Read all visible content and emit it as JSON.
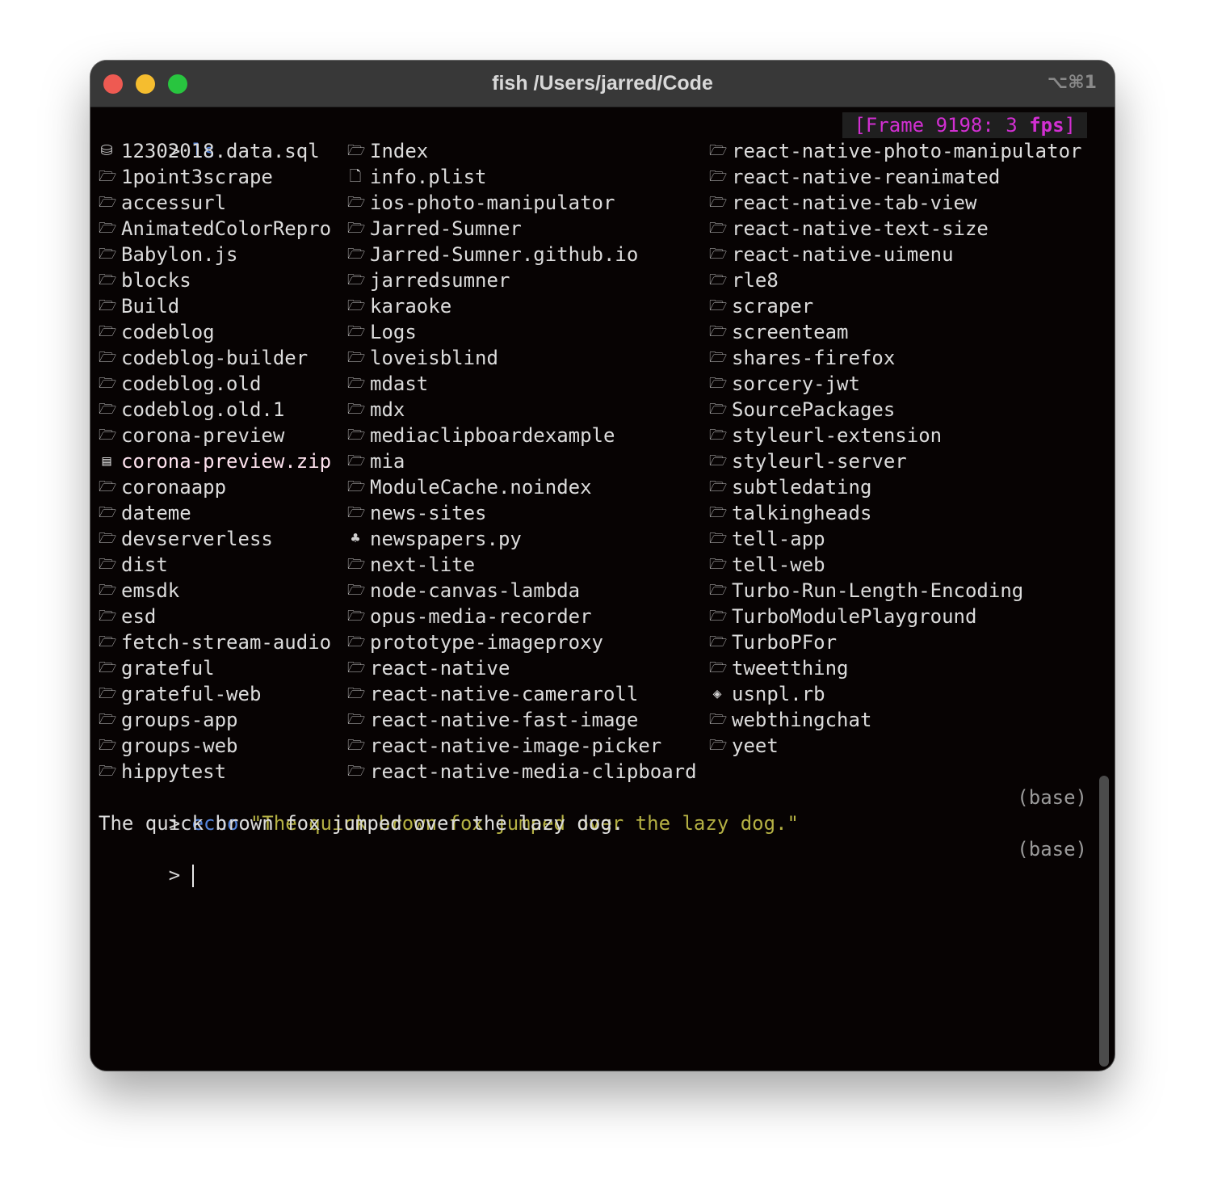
{
  "window": {
    "title": "fish /Users/jarred/Code",
    "shortcut": "⌥⌘1"
  },
  "colors": {
    "background": "#070303",
    "titlebar": "#383838",
    "command": "#5585dc",
    "string": "#b5b144",
    "fps": "#d22fd2",
    "zip": "#ffe3ef"
  },
  "overlay": {
    "frame_prefix": "[Frame 9198: 3 ",
    "frame_fps": "fps",
    "frame_suffix": "]"
  },
  "prompt_symbol": ">",
  "first_command": "ls",
  "listing": {
    "columns": [
      [
        {
          "icon": "database-icon",
          "name": "12302018.data.sql"
        },
        {
          "icon": "folder-icon",
          "name": "1point3scrape"
        },
        {
          "icon": "folder-icon",
          "name": "accessurl"
        },
        {
          "icon": "folder-icon",
          "name": "AnimatedColorRepro"
        },
        {
          "icon": "folder-icon",
          "name": "Babylon.js"
        },
        {
          "icon": "folder-icon",
          "name": "blocks"
        },
        {
          "icon": "folder-icon",
          "name": "Build"
        },
        {
          "icon": "folder-icon",
          "name": "codeblog"
        },
        {
          "icon": "folder-icon",
          "name": "codeblog-builder"
        },
        {
          "icon": "folder-icon",
          "name": "codeblog.old"
        },
        {
          "icon": "folder-icon",
          "name": "codeblog.old.1"
        },
        {
          "icon": "folder-icon",
          "name": "corona-preview"
        },
        {
          "icon": "zip-icon",
          "name": "corona-preview.zip"
        },
        {
          "icon": "folder-icon",
          "name": "coronaapp"
        },
        {
          "icon": "folder-icon",
          "name": "dateme"
        },
        {
          "icon": "folder-icon",
          "name": "devserverless"
        },
        {
          "icon": "folder-icon",
          "name": "dist"
        },
        {
          "icon": "folder-icon",
          "name": "emsdk"
        },
        {
          "icon": "folder-icon",
          "name": "esd"
        },
        {
          "icon": "folder-icon",
          "name": "fetch-stream-audio"
        },
        {
          "icon": "folder-icon",
          "name": "grateful"
        },
        {
          "icon": "folder-icon",
          "name": "grateful-web"
        },
        {
          "icon": "folder-icon",
          "name": "groups-app"
        },
        {
          "icon": "folder-icon",
          "name": "groups-web"
        },
        {
          "icon": "folder-icon",
          "name": "hippytest"
        }
      ],
      [
        {
          "icon": "folder-icon",
          "name": "Index"
        },
        {
          "icon": "file-icon",
          "name": "info.plist"
        },
        {
          "icon": "folder-icon",
          "name": "ios-photo-manipulator"
        },
        {
          "icon": "folder-icon",
          "name": "Jarred-Sumner"
        },
        {
          "icon": "folder-icon",
          "name": "Jarred-Sumner.github.io"
        },
        {
          "icon": "folder-icon",
          "name": "jarredsumner"
        },
        {
          "icon": "folder-icon",
          "name": "karaoke"
        },
        {
          "icon": "folder-icon",
          "name": "Logs"
        },
        {
          "icon": "folder-icon",
          "name": "loveisblind"
        },
        {
          "icon": "folder-icon",
          "name": "mdast"
        },
        {
          "icon": "folder-icon",
          "name": "mdx"
        },
        {
          "icon": "folder-icon",
          "name": "mediaclipboardexample"
        },
        {
          "icon": "folder-icon",
          "name": "mia"
        },
        {
          "icon": "folder-icon",
          "name": "ModuleCache.noindex"
        },
        {
          "icon": "folder-icon",
          "name": "news-sites"
        },
        {
          "icon": "python-icon",
          "name": "newspapers.py"
        },
        {
          "icon": "folder-icon",
          "name": "next-lite"
        },
        {
          "icon": "folder-icon",
          "name": "node-canvas-lambda"
        },
        {
          "icon": "folder-icon",
          "name": "opus-media-recorder"
        },
        {
          "icon": "folder-icon",
          "name": "prototype-imageproxy"
        },
        {
          "icon": "folder-icon",
          "name": "react-native"
        },
        {
          "icon": "folder-icon",
          "name": "react-native-cameraroll"
        },
        {
          "icon": "folder-icon",
          "name": "react-native-fast-image"
        },
        {
          "icon": "folder-icon",
          "name": "react-native-image-picker"
        },
        {
          "icon": "folder-icon",
          "name": "react-native-media-clipboard"
        }
      ],
      [
        {
          "icon": "folder-icon",
          "name": "react-native-photo-manipulator"
        },
        {
          "icon": "folder-icon",
          "name": "react-native-reanimated"
        },
        {
          "icon": "folder-icon",
          "name": "react-native-tab-view"
        },
        {
          "icon": "folder-icon",
          "name": "react-native-text-size"
        },
        {
          "icon": "folder-icon",
          "name": "react-native-uimenu"
        },
        {
          "icon": "folder-icon",
          "name": "rle8"
        },
        {
          "icon": "folder-icon",
          "name": "scraper"
        },
        {
          "icon": "folder-icon",
          "name": "screenteam"
        },
        {
          "icon": "folder-icon",
          "name": "shares-firefox"
        },
        {
          "icon": "folder-icon",
          "name": "sorcery-jwt"
        },
        {
          "icon": "folder-icon",
          "name": "SourcePackages"
        },
        {
          "icon": "folder-icon",
          "name": "styleurl-extension"
        },
        {
          "icon": "folder-icon",
          "name": "styleurl-server"
        },
        {
          "icon": "folder-icon",
          "name": "subtledating"
        },
        {
          "icon": "folder-icon",
          "name": "talkingheads"
        },
        {
          "icon": "folder-icon",
          "name": "tell-app"
        },
        {
          "icon": "folder-icon",
          "name": "tell-web"
        },
        {
          "icon": "folder-icon",
          "name": "Turbo-Run-Length-Encoding"
        },
        {
          "icon": "folder-icon",
          "name": "TurboModulePlayground"
        },
        {
          "icon": "folder-icon",
          "name": "TurboPFor"
        },
        {
          "icon": "folder-icon",
          "name": "tweetthing"
        },
        {
          "icon": "ruby-icon",
          "name": "usnpl.rb"
        },
        {
          "icon": "folder-icon",
          "name": "webthingchat"
        },
        {
          "icon": "folder-icon",
          "name": "yeet"
        }
      ]
    ]
  },
  "echo_line": {
    "command": "echo",
    "argument": "\"The quick brown fox jumped over the lazy dog.\"",
    "env": "(base)"
  },
  "echo_output": "The quick brown fox jumped over the lazy dog.",
  "current_line": {
    "env": "(base)"
  }
}
